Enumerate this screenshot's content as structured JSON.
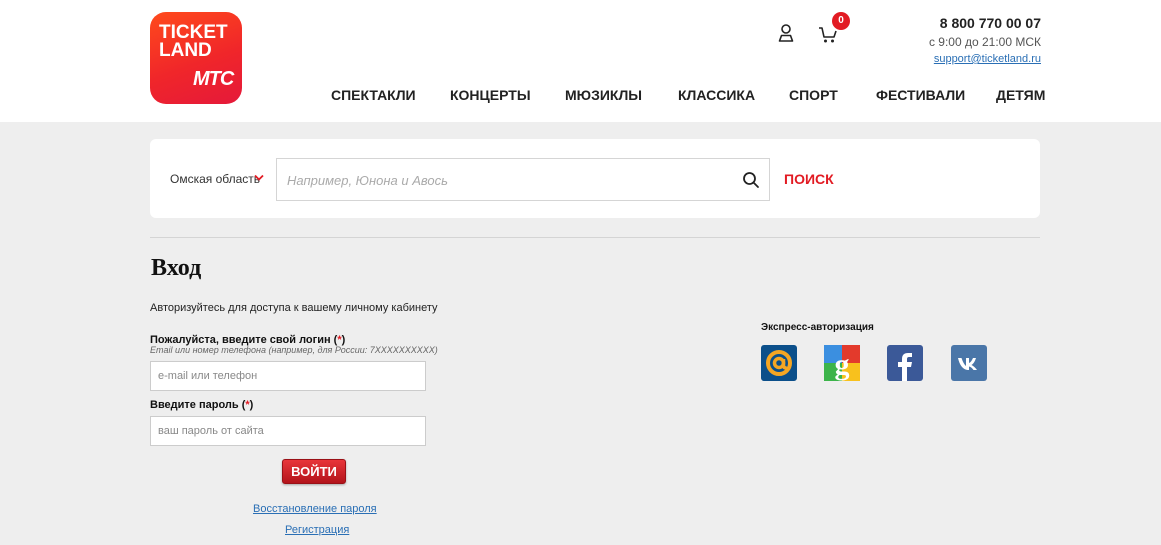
{
  "logo": {
    "line1": "TICKET",
    "line2": "LAND",
    "line3": "МТС"
  },
  "header": {
    "cart_count": "0",
    "phone": "8 800 770 00 07",
    "hours": "с 9:00 до 21:00 МСК",
    "support_email": "support@ticketland.ru"
  },
  "nav": {
    "items": [
      "СПЕКТАКЛИ",
      "КОНЦЕРТЫ",
      "МЮЗИКЛЫ",
      "КЛАССИКА",
      "СПОРТ",
      "ФЕСТИВАЛИ",
      "ДЕТЯМ"
    ]
  },
  "search": {
    "region": "Омская область",
    "placeholder": "Например, Юнона и Авось",
    "button": "ПОИСК"
  },
  "login": {
    "title": "Вход",
    "subtitle": "Авторизуйтесь для доступа к вашему личному кабинету",
    "login_label": "Пожалуйста, введите свой логин (",
    "required_mark": "*",
    "label_close": ")",
    "login_hint": "Email или номер телефона (например, для России: 7XXXXXXXXXX)",
    "login_placeholder": "e-mail или телефон",
    "password_label": "Введите пароль (",
    "password_placeholder": "ваш пароль от сайта",
    "submit": "ВОЙТИ",
    "recover": "Восстановление пароля",
    "register": "Регистрация"
  },
  "express": {
    "title": "Экспресс-авторизация",
    "providers": [
      "mail-ru",
      "google",
      "facebook",
      "vk"
    ]
  },
  "colors": {
    "accent": "#e21b23",
    "link": "#2a6fb5",
    "background": "#eeeeee"
  }
}
